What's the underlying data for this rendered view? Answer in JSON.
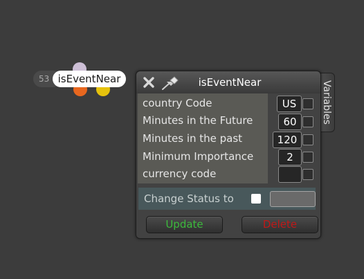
{
  "node": {
    "id": "53",
    "label": "isEventNear"
  },
  "panel": {
    "title": "isEventNear",
    "side_tab": "Variables",
    "params": [
      {
        "label": "country Code",
        "value": "US"
      },
      {
        "label": "Minutes in the Future",
        "value": "60"
      },
      {
        "label": "Minutes in the past",
        "value": "120"
      },
      {
        "label": "Minimum Importance",
        "value": "2"
      },
      {
        "label": "currency code",
        "value": ""
      }
    ],
    "status_label": "Change Status to",
    "update_label": "Update",
    "delete_label": "Delete"
  },
  "colors": {
    "background": "#3c3c3c",
    "update_text": "#3cb93c",
    "delete_text": "#c01818",
    "output_orange": "#e8671f",
    "output_yellow": "#e6c20d"
  },
  "icons": [
    "close-icon",
    "pin-icon"
  ]
}
